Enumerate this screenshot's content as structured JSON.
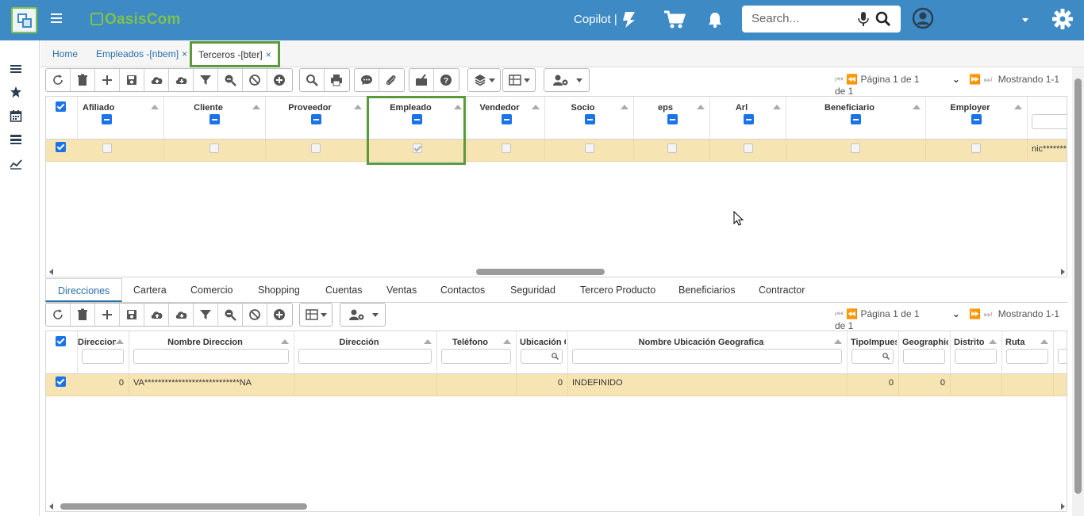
{
  "header": {
    "logo_text": "OasisCom",
    "copilot_label": "Copilot |",
    "search_placeholder": "Search...",
    "accent_color": "#3e8ac4",
    "highlight_color": "#5a9a3c"
  },
  "window_tabs": [
    {
      "label": "Home",
      "close": ""
    },
    {
      "label": "Empleados -[nbem]",
      "close": "×"
    },
    {
      "label": "Terceros -[bter]",
      "close": "×"
    }
  ],
  "left_rail": [
    "menu-icon",
    "star-icon",
    "calendar-icon",
    "list-icon",
    "chart-icon"
  ],
  "top_grid": {
    "pager_text": "Página 1 de 1",
    "showing_text": "Mostrando 1-1 de 1",
    "columns": [
      "Afiliado",
      "Cliente",
      "Proveedor",
      "Empleado",
      "Vendedor",
      "Socio",
      "eps",
      "Arl",
      "Beneficiario",
      "Employer"
    ],
    "row": {
      "selected": true,
      "Afiliado": false,
      "Cliente": false,
      "Proveedor": false,
      "Empleado": true,
      "Vendedor": false,
      "Socio": false,
      "eps": false,
      "Arl": false,
      "Beneficiario": false,
      "Employer": false,
      "trailing_text": "nic*******"
    }
  },
  "detail_tabs": [
    "Direcciones",
    "Cartera",
    "Comercio",
    "Shopping",
    "Cuentas",
    "Ventas",
    "Contactos",
    "Seguridad",
    "Tercero Producto",
    "Beneficiarios",
    "Contractor"
  ],
  "bottom_grid": {
    "pager_text": "Página 1 de 1",
    "showing_text": "Mostrando 1-1 de 1",
    "columns": [
      "Direccion",
      "Nombre Direccion",
      "Dirección",
      "Teléfono",
      "Ubicación Geografica",
      "Nombre Ubicación Geografica",
      "TipoImpuesto",
      "Geographic",
      "Distrito",
      "Ruta"
    ],
    "row": {
      "Direccion": "0",
      "Nombre Direccion": "VA****************************NA",
      "Direccion2": "",
      "Telefono": "",
      "Ubicacion": "0",
      "Nombre Ubicacion": "INDEFINIDO",
      "TipoImpuesto": "0",
      "Geographic": "0",
      "Distrito": "",
      "Ruta": ""
    }
  }
}
